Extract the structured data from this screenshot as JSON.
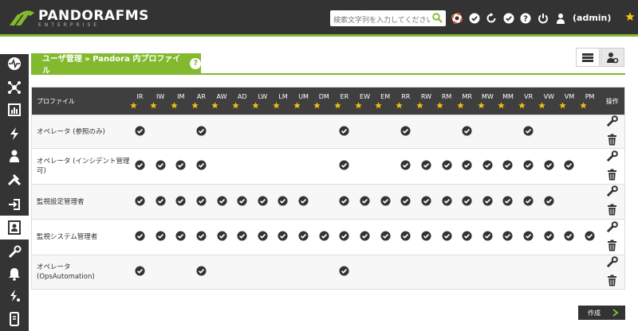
{
  "header": {
    "brand": "PANDORAFMS",
    "sub": "ENTERPRISE",
    "search_placeholder": "検索文字列を入力してください",
    "user": "(admin)"
  },
  "tab": {
    "title": "ユーザ管理 » Pandora 内プロファイル",
    "help": "?"
  },
  "table": {
    "profile_header": "プロファイル",
    "ops_header": "操作",
    "columns": [
      "IR",
      "IW",
      "IM",
      "AR",
      "AW",
      "AD",
      "LW",
      "LM",
      "UM",
      "DM",
      "ER",
      "EW",
      "EM",
      "RR",
      "RW",
      "RM",
      "MR",
      "MW",
      "MM",
      "VR",
      "VW",
      "VM",
      "PM"
    ],
    "rows": [
      {
        "name": "オペレータ (参照のみ)",
        "perms": [
          1,
          0,
          0,
          1,
          0,
          0,
          0,
          0,
          0,
          0,
          1,
          0,
          0,
          1,
          0,
          0,
          1,
          0,
          0,
          1,
          0,
          0,
          0
        ]
      },
      {
        "name": "オペレータ (インシデント管理可)",
        "perms": [
          1,
          1,
          1,
          1,
          0,
          0,
          0,
          0,
          0,
          0,
          1,
          0,
          0,
          1,
          1,
          1,
          1,
          1,
          1,
          1,
          1,
          1,
          0
        ]
      },
      {
        "name": "監視設定管理者",
        "perms": [
          1,
          1,
          1,
          1,
          1,
          1,
          1,
          1,
          1,
          0,
          1,
          1,
          1,
          1,
          1,
          1,
          1,
          1,
          1,
          1,
          1,
          0,
          0
        ]
      },
      {
        "name": "監視システム管理者",
        "perms": [
          1,
          1,
          1,
          1,
          1,
          1,
          1,
          1,
          1,
          1,
          1,
          1,
          1,
          1,
          1,
          1,
          1,
          1,
          1,
          1,
          1,
          1,
          1
        ]
      },
      {
        "name": "オペレータ (OpsAutomation)",
        "perms": [
          1,
          0,
          0,
          1,
          0,
          0,
          0,
          0,
          0,
          0,
          1,
          0,
          0,
          0,
          0,
          0,
          0,
          0,
          0,
          0,
          0,
          0,
          0
        ]
      }
    ]
  },
  "buttons": {
    "create": "作成"
  },
  "colors": {
    "accent": "#82b92e",
    "dark": "#333333",
    "star": "#f4c20d"
  }
}
